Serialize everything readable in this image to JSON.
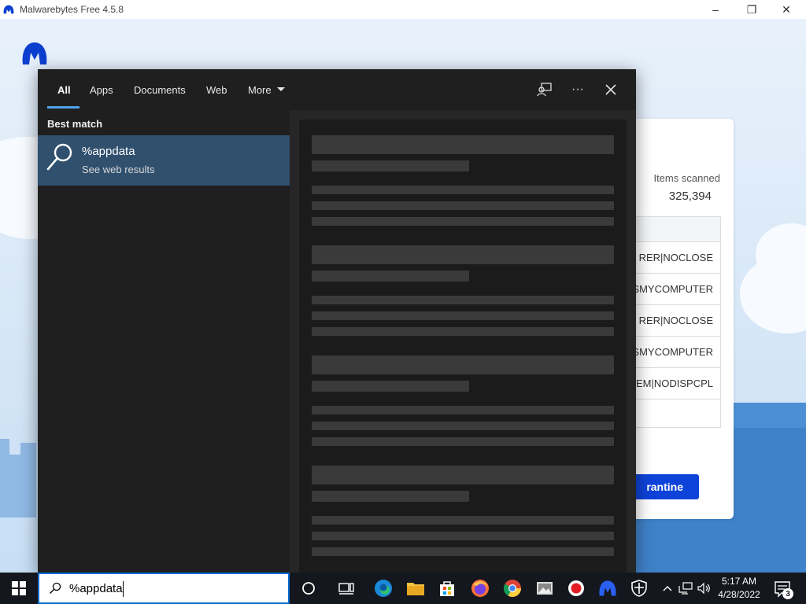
{
  "app": {
    "title": "Malwarebytes Free  4.5.8",
    "items_scanned_label": "Items scanned",
    "items_scanned_value": "325,394",
    "detections": [
      "RER|NOCLOSE",
      "ESMYCOMPUTER",
      "RER|NOCLOSE",
      "ESMYCOMPUTER",
      "TEM|NODISPCPL"
    ],
    "quarantine_label": "rantine"
  },
  "search": {
    "tabs": [
      {
        "label": "All"
      },
      {
        "label": "Apps"
      },
      {
        "label": "Documents"
      },
      {
        "label": "Web"
      },
      {
        "label": "More"
      }
    ],
    "best_match_label": "Best match",
    "result": {
      "title": "%appdata",
      "subtitle": "See web results"
    },
    "query": "%appdata"
  },
  "taskbar": {
    "apps": [
      "cortana-icon",
      "task-view-icon",
      "edge-icon",
      "file-explorer-icon",
      "store-icon",
      "firefox-icon",
      "chrome-icon",
      "photos-icon",
      "record-icon",
      "malwarebytes-icon",
      "security-icon"
    ],
    "time": "5:17 AM",
    "date": "4/28/2022",
    "notification_count": "3"
  },
  "colors": {
    "accent": "#4ea3f1",
    "selected_result": "#30506e",
    "panel_bg": "#1f1f1f",
    "brand": "#0d43d8"
  }
}
